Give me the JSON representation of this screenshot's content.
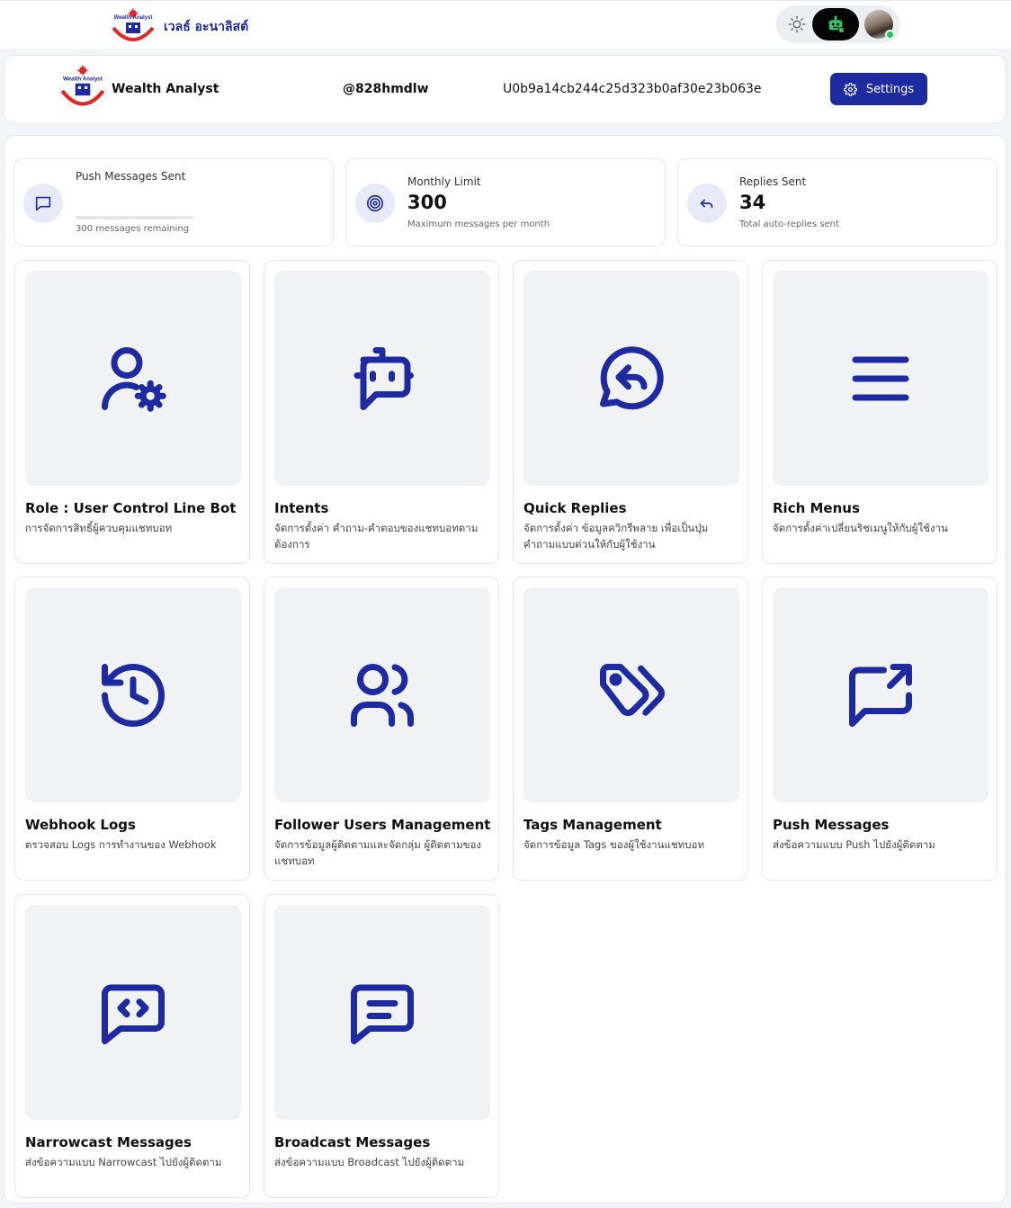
{
  "app": {
    "logo_alt": "Wealth Analyst",
    "brand_name": "เวลธ์ อะนาลิสต์",
    "accent_color": "#1e2aa0",
    "theme_toggle_icon": "sun-icon",
    "bot_button_icon": "robot-icon",
    "user_online": true
  },
  "bot": {
    "name": "Wealth Analyst",
    "basic_id": "@828hmdlw",
    "user_id": "U0b9a14cb244c25d323b0af30e23b063e",
    "settings_label": "Settings"
  },
  "stats": [
    {
      "label": "Push Messages Sent",
      "value": "",
      "sub": "300 messages remaining",
      "icon": "chat-icon",
      "progress": 0
    },
    {
      "label": "Monthly Limit",
      "value": "300",
      "sub": "Maximum messages per month",
      "icon": "target-icon"
    },
    {
      "label": "Replies Sent",
      "value": "34",
      "sub": "Total auto-replies sent",
      "icon": "reply-icon"
    }
  ],
  "cards": [
    {
      "title": "Role : User Control Line Bot",
      "desc": "การจัดการสิทธิ์ผู้ควบคุมแชทบอท",
      "icon": "user-settings-icon"
    },
    {
      "title": "Intents",
      "desc": "จัดการตั้งค่า คำถาม-คำตอบของแชทบอทตามต้องการ",
      "icon": "robot-icon"
    },
    {
      "title": "Quick Replies",
      "desc": "จัดการตั้งค่า ข้อมูลควิกรีพลาย เพื่อเป็นปุ่มคำถามแบบด่วนให้กับผู้ใช้งาน",
      "icon": "reply-bubble-icon"
    },
    {
      "title": "Rich Menus",
      "desc": "จัดการตั้งค่าเปลี่ยนริชเมนูให้กับผู้ใช้งาน",
      "icon": "menu-icon"
    },
    {
      "title": "Webhook Logs",
      "desc": "ตรวจสอบ Logs การทำงานของ Webhook",
      "icon": "history-icon"
    },
    {
      "title": "Follower Users Management",
      "desc": "จัดการข้อมูลผู้ติดตามและจัดกลุ่ม ผู้ติดตามของแชทบอท",
      "icon": "users-icon"
    },
    {
      "title": "Tags Management",
      "desc": "จัดการข้อมูล Tags ของผู้ใช้งานแชทบอท",
      "icon": "tags-icon"
    },
    {
      "title": "Push Messages",
      "desc": "ส่งข้อความแบบ Push ไปยังผู้ติดตาม",
      "icon": "message-share-icon"
    },
    {
      "title": "Narrowcast Messages",
      "desc": "ส่งข้อความแบบ Narrowcast ไปยังผู้ติดตาม",
      "icon": "message-code-icon"
    },
    {
      "title": "Broadcast Messages",
      "desc": "ส่งข้อความแบบ Broadcast ไปยังผู้ติดตาม",
      "icon": "message-text-icon"
    }
  ]
}
